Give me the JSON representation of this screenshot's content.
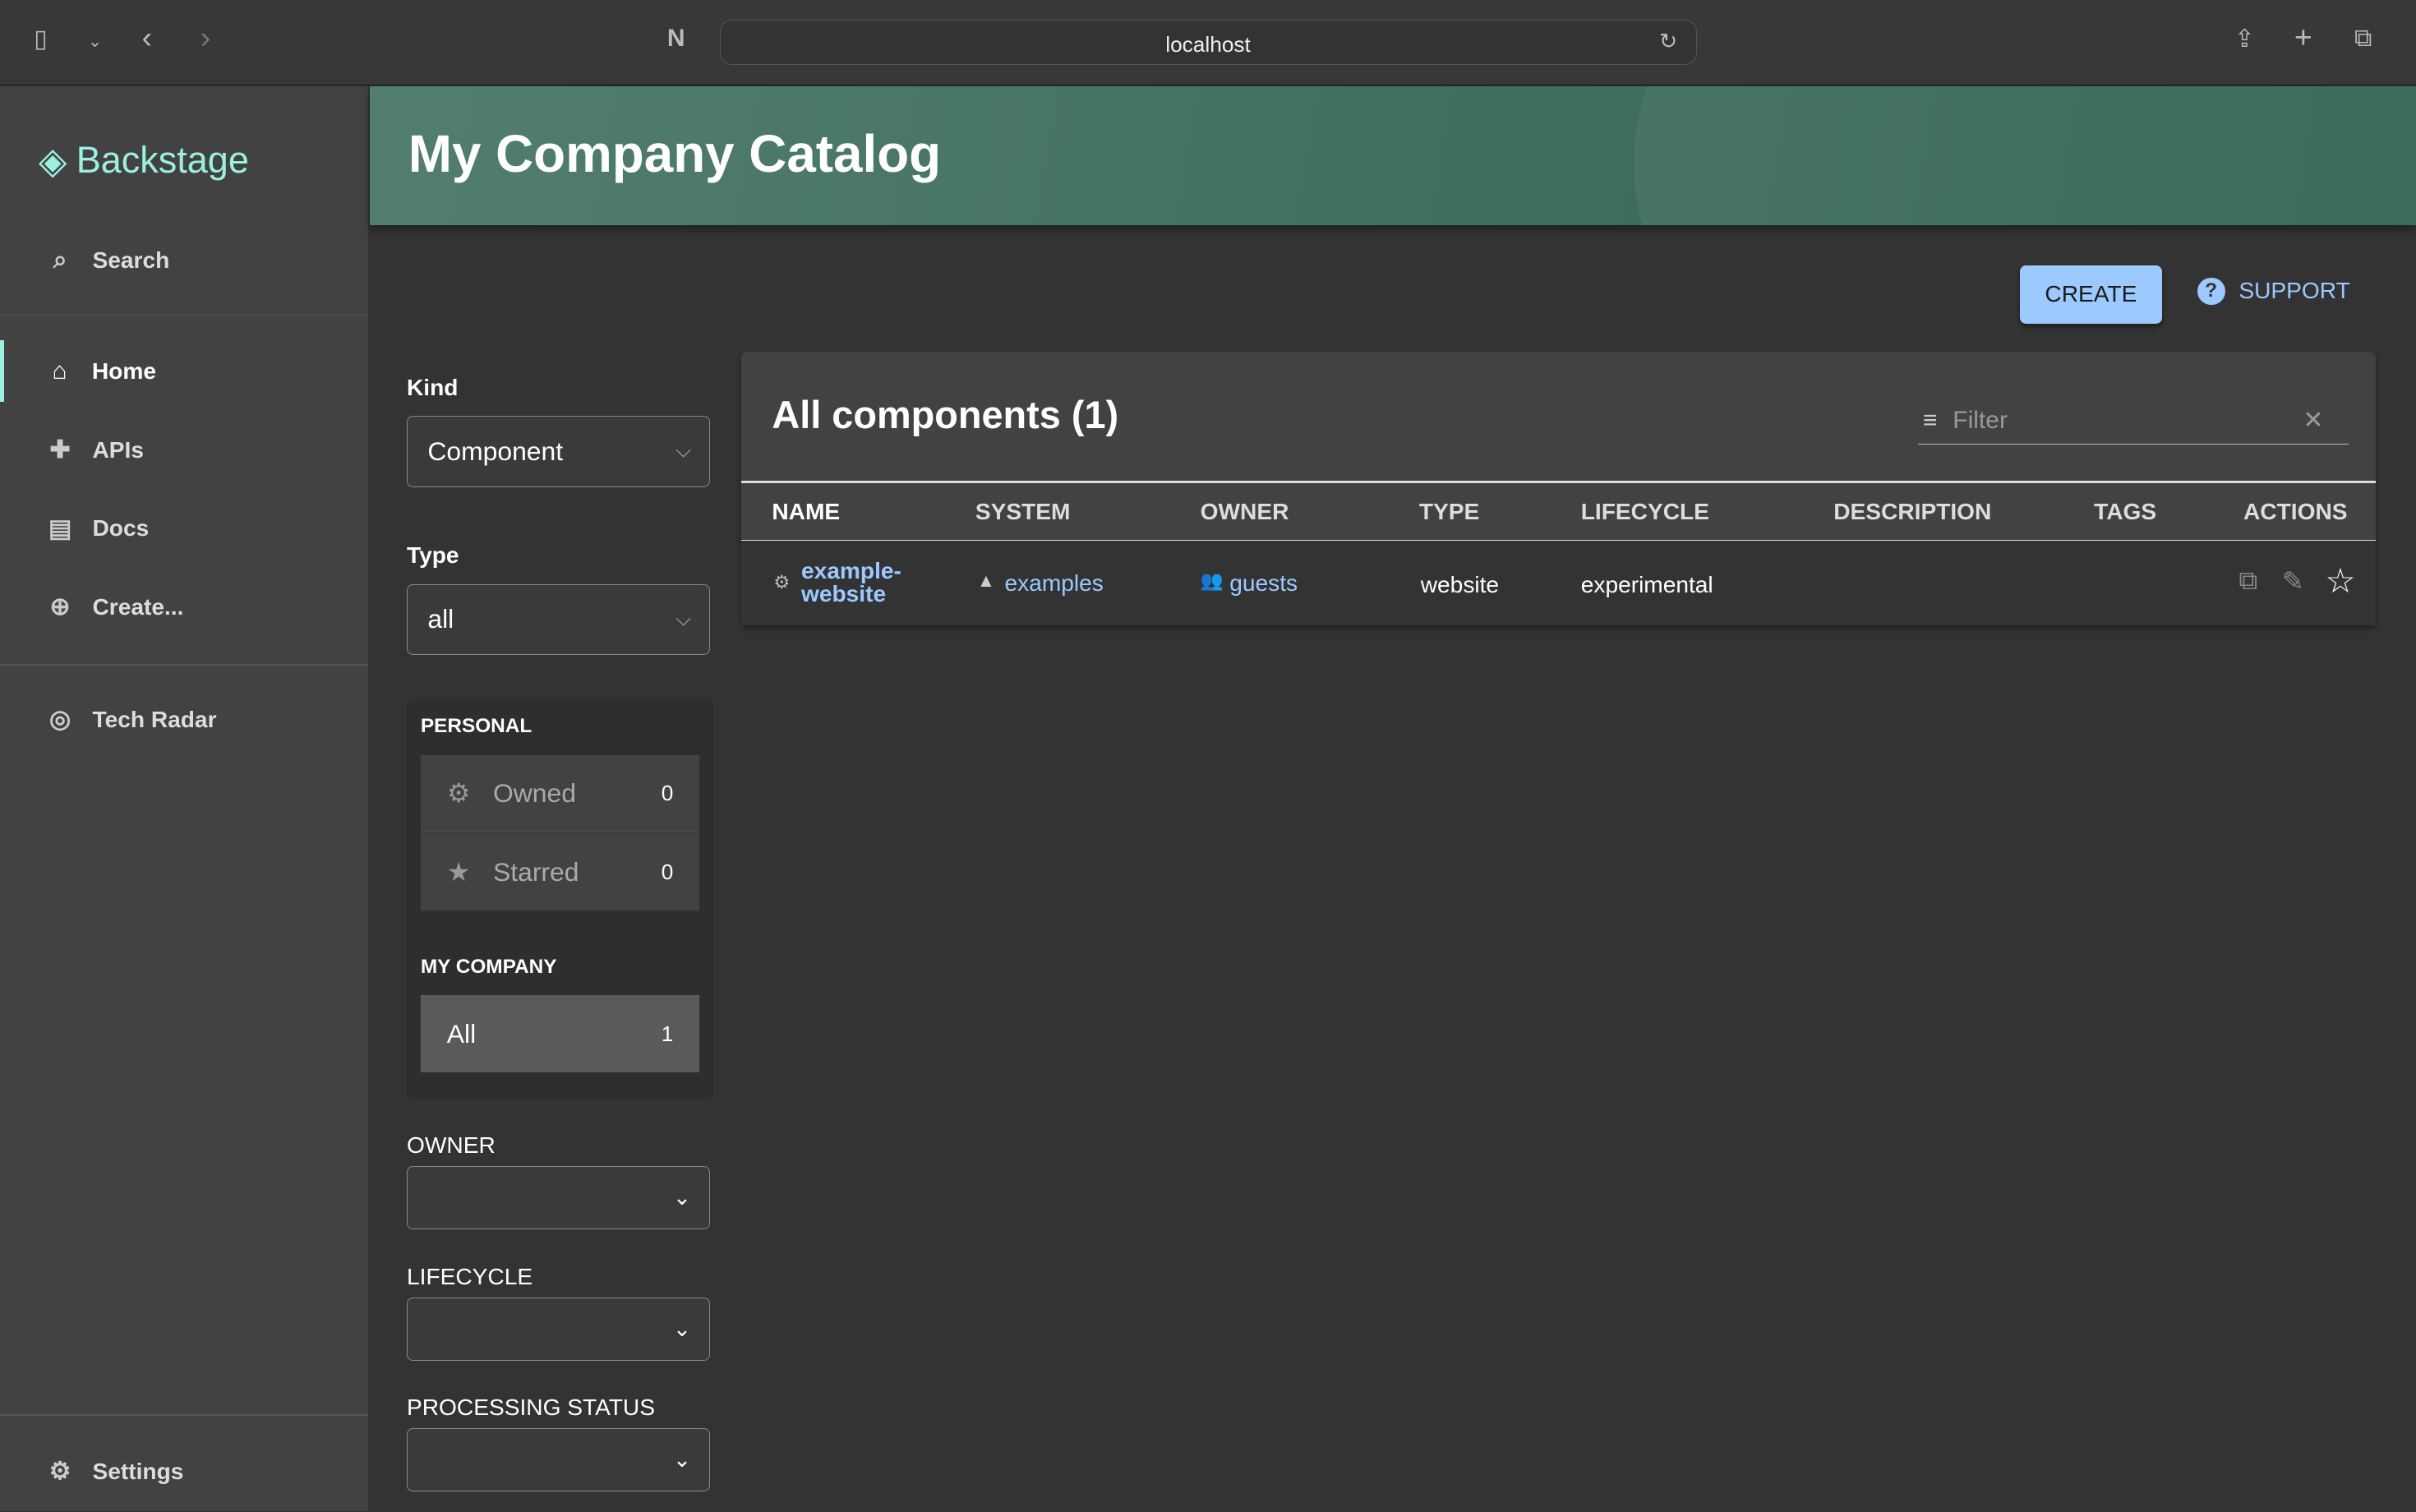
{
  "browser": {
    "url": "localhost"
  },
  "sidebar": {
    "logo": "Backstage",
    "search": "Search",
    "items": [
      {
        "label": "Home"
      },
      {
        "label": "APIs"
      },
      {
        "label": "Docs"
      },
      {
        "label": "Create..."
      },
      {
        "label": "Tech Radar"
      }
    ],
    "settings": "Settings"
  },
  "header": {
    "title": "My Company Catalog"
  },
  "actions": {
    "create": "CREATE",
    "support": "SUPPORT"
  },
  "filters": {
    "kind_label": "Kind",
    "kind_value": "Component",
    "type_label": "Type",
    "type_value": "all",
    "personal_title": "PERSONAL",
    "owned": "Owned",
    "owned_count": "0",
    "starred": "Starred",
    "starred_count": "0",
    "company_title": "MY COMPANY",
    "all": "All",
    "all_count": "1",
    "owner_label": "OWNER",
    "lifecycle_label": "LIFECYCLE",
    "status_label": "PROCESSING STATUS"
  },
  "table": {
    "title": "All components (1)",
    "filter_placeholder": "Filter",
    "columns": [
      "NAME",
      "SYSTEM",
      "OWNER",
      "TYPE",
      "LIFECYCLE",
      "DESCRIPTION",
      "TAGS",
      "ACTIONS"
    ],
    "rows": [
      {
        "name_1": "example-",
        "name_2": "website",
        "system": "examples",
        "owner": "guests",
        "type": "website",
        "lifecycle": "experimental"
      }
    ]
  }
}
